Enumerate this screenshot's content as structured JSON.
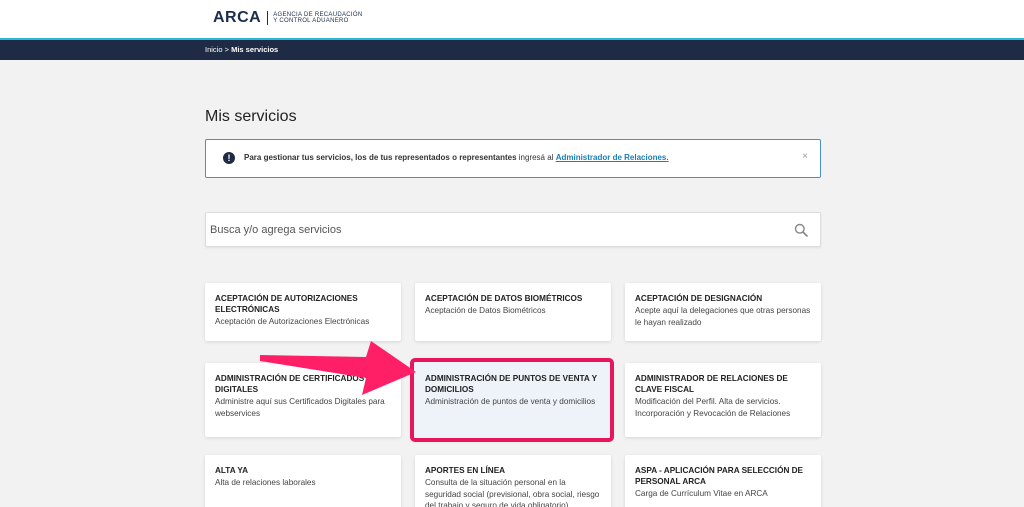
{
  "header": {
    "logo_word": "ARCA",
    "logo_sub_1": "AGENCIA DE RECAUDACIÓN",
    "logo_sub_2": "Y CONTROL ADUANERO"
  },
  "breadcrumb": {
    "home": "Inicio",
    "sep": ">",
    "current": "Mis servicios"
  },
  "page": {
    "title": "Mis servicios"
  },
  "alert": {
    "bold_text": "Para gestionar tus servicios, los de tus representados o representantes",
    "plain_text": " ingresá al ",
    "link_text": "Administrador de Relaciones",
    "close": "×"
  },
  "search": {
    "placeholder": "Busca y/o agrega servicios"
  },
  "services": [
    {
      "title": "ACEPTACIÓN DE AUTORIZACIONES ELECTRÓNICAS",
      "desc": "Aceptación de Autorizaciones Electrónicas"
    },
    {
      "title": "ACEPTACIÓN DE DATOS BIOMÉTRICOS",
      "desc": "Aceptación de Datos Biométricos"
    },
    {
      "title": "ACEPTACIÓN DE DESIGNACIÓN",
      "desc": "Acepte aquí la delegaciones que otras personas le hayan realizado"
    },
    {
      "title": "ADMINISTRACIÓN DE CERTIFICADOS DIGITALES",
      "desc": "Administre aquí sus Certificados Digitales para webservices"
    },
    {
      "title": "ADMINISTRACIÓN DE PUNTOS DE VENTA Y DOMICILIOS",
      "desc": "Administración de puntos de venta y domicilios"
    },
    {
      "title": "ADMINISTRADOR DE RELACIONES DE CLAVE FISCAL",
      "desc": "Modificación del Perfil. Alta de servicios. Incorporación y Revocación de Relaciones"
    },
    {
      "title": "ALTA YA",
      "desc": "Alta de relaciones laborales"
    },
    {
      "title": "APORTES EN LÍNEA",
      "desc": "Consulta de la situación personal en la seguridad social (previsional, obra social, riesgo del trabajo y seguro de vida obligatorio)"
    },
    {
      "title": "ASPA - APLICACIÓN PARA SELECCIÓN DE PERSONAL ARCA",
      "desc": "Carga de Currículum Vitae en ARCA"
    }
  ],
  "colors": {
    "navbar": "#1f2b45",
    "accent": "#29b6d8",
    "highlight": "#e8155a",
    "link": "#1a7db8"
  }
}
